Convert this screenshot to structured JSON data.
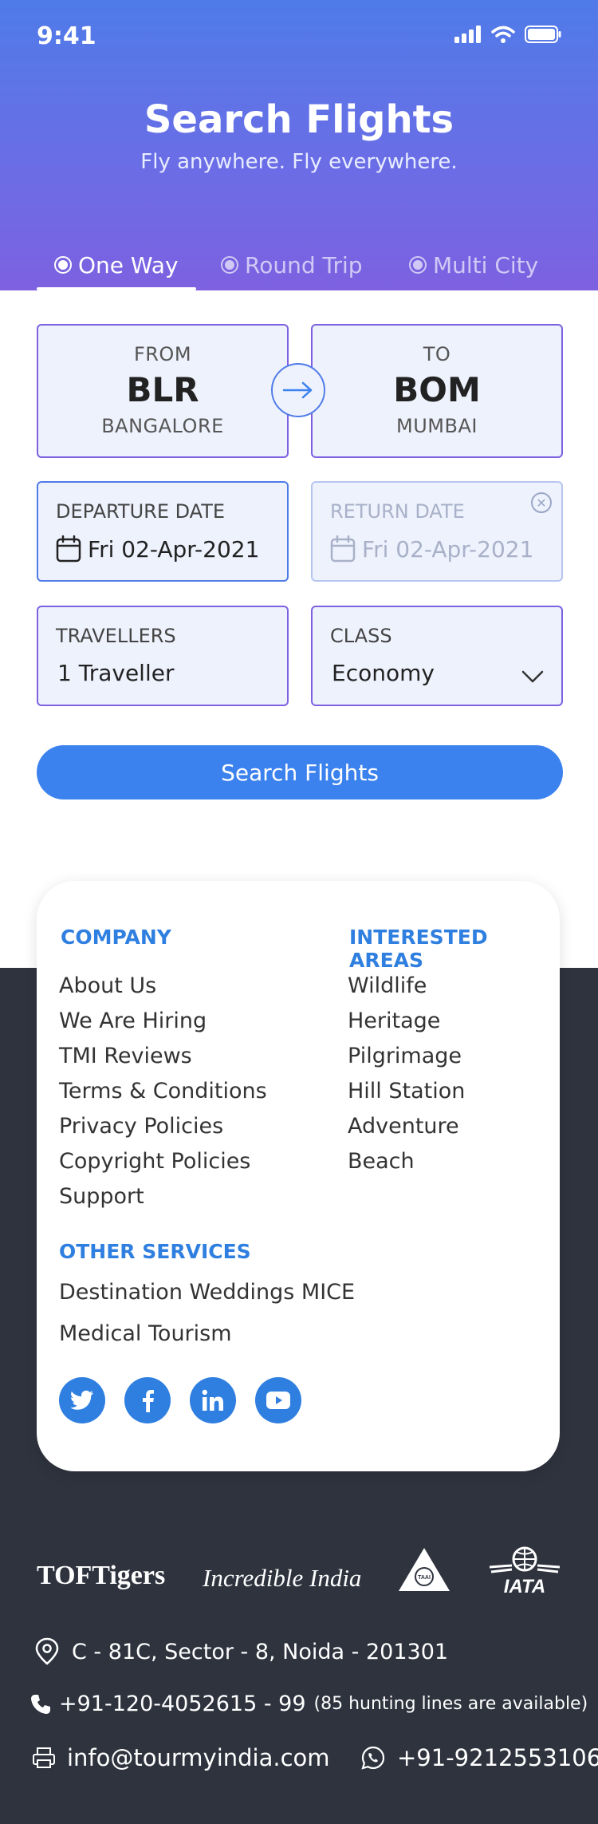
{
  "status": {
    "time": "9:41"
  },
  "header": {
    "title": "Search Flights",
    "subtitle": "Fly anywhere. Fly everywhere."
  },
  "tabs": [
    {
      "label": "One Way",
      "active": true
    },
    {
      "label": "Round Trip",
      "active": false
    },
    {
      "label": "Multi City",
      "active": false
    }
  ],
  "from": {
    "label": "FROM",
    "code": "BLR",
    "city": "BANGALORE"
  },
  "to": {
    "label": "TO",
    "code": "BOM",
    "city": "MUMBAI"
  },
  "departure": {
    "label": "DEPARTURE DATE",
    "value": "Fri 02-Apr-2021"
  },
  "return": {
    "label": "RETURN DATE",
    "value": "Fri 02-Apr-2021"
  },
  "travellers": {
    "label": "TRAVELLERS",
    "value": "1 Traveller"
  },
  "class": {
    "label": "CLASS",
    "value": "Economy"
  },
  "search_button": "Search Flights",
  "footer": {
    "company_heading": "COMPANY",
    "company_links": [
      "About Us",
      "We Are Hiring",
      "TMI Reviews",
      "Terms & Conditions",
      "Privacy Policies",
      "Copyright Policies",
      "Support"
    ],
    "areas_heading": "INTERESTED AREAS",
    "areas_links": [
      "Wildlife",
      "Heritage",
      "Pilgrimage",
      "Hill Station",
      "Adventure",
      "Beach"
    ],
    "services_heading": "OTHER SERVICES",
    "services_links": [
      "Destination Weddings MICE",
      "Medical Tourism"
    ],
    "social": [
      "twitter-icon",
      "facebook-icon",
      "linkedin-icon",
      "youtube-icon"
    ]
  },
  "logos": {
    "toftigers": "TOFTigers",
    "incredible_india": "Incredible India",
    "taai": "TAAI",
    "iata": "IATA"
  },
  "contact": {
    "address": "C - 81C, Sector - 8, Noida - 201301",
    "phone": "+91-120-4052615 - 99",
    "phone_note": "(85 hunting lines are available)",
    "email": "info@tourmyindia.com",
    "whatsapp": "+91-9212553106"
  },
  "colors": {
    "primary": "#3b82ee",
    "header_start": "#4f7be8",
    "header_end": "#7d61e0",
    "footer_bg": "#2e333e",
    "heading": "#2f7fe0"
  }
}
